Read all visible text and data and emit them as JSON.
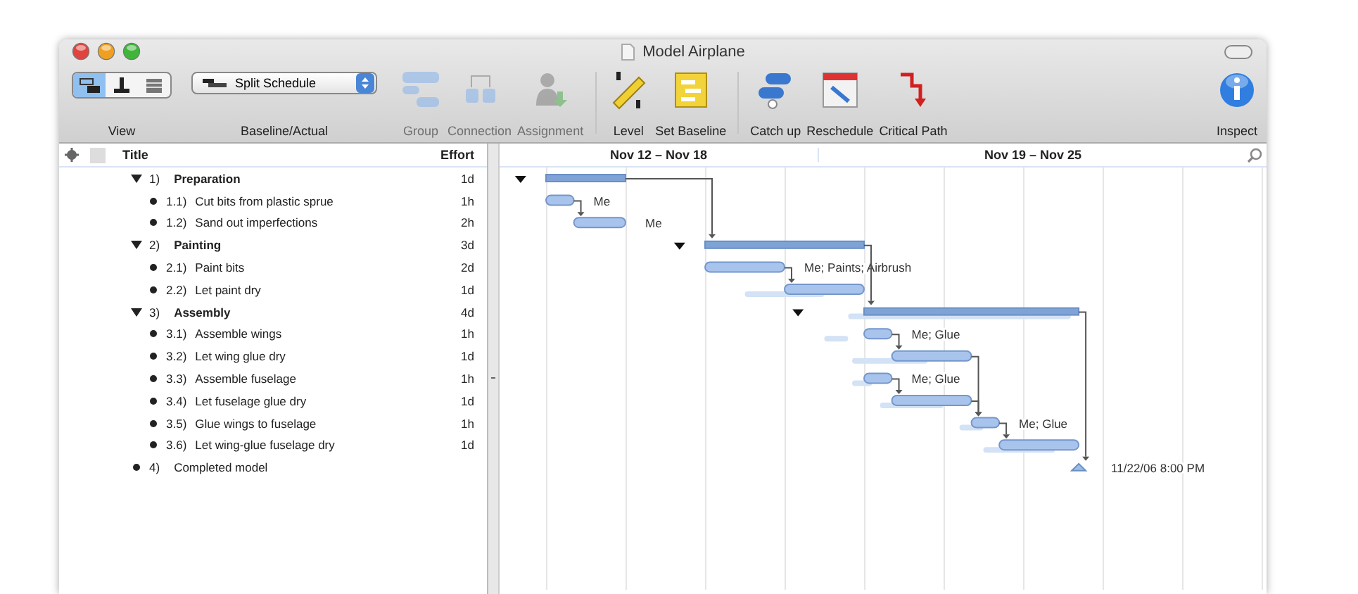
{
  "window": {
    "title": "Model Airplane"
  },
  "toolbar": {
    "view": {
      "label": "View",
      "segments": [
        {
          "selected": true
        },
        {
          "selected": false
        },
        {
          "selected": false
        }
      ]
    },
    "baseline": {
      "label": "Baseline/Actual",
      "value": "Split Schedule"
    },
    "buttons": [
      {
        "kind": "group",
        "label": "Group",
        "disabled": true
      },
      {
        "kind": "connection",
        "label": "Connection",
        "disabled": true
      },
      {
        "kind": "assignment",
        "label": "Assignment",
        "disabled": true
      },
      {
        "kind": "level",
        "label": "Level",
        "disabled": false
      },
      {
        "kind": "baseline",
        "label": "Set Baseline",
        "disabled": false
      },
      {
        "kind": "catchup",
        "label": "Catch up",
        "disabled": false
      },
      {
        "kind": "reschedule",
        "label": "Reschedule",
        "disabled": false
      },
      {
        "kind": "critical",
        "label": "Critical Path",
        "disabled": false
      },
      {
        "kind": "inspect",
        "label": "Inspect",
        "disabled": false
      }
    ]
  },
  "outline": {
    "columns": [
      "Title",
      "Effort"
    ],
    "tasks": [
      {
        "number": "1)",
        "title": "Preparation",
        "effort": "1d",
        "expanded": true,
        "children": [
          {
            "number": "1.1)",
            "title": "Cut bits from plastic sprue",
            "effort": "1h",
            "assigned": "Me"
          },
          {
            "number": "1.2)",
            "title": "Sand out imperfections",
            "effort": "2h",
            "assigned": "Me"
          }
        ]
      },
      {
        "number": "2)",
        "title": "Painting",
        "effort": "3d",
        "expanded": true,
        "children": [
          {
            "number": "2.1)",
            "title": "Paint bits",
            "effort": "2d",
            "assigned": "Me; Paints; Airbrush"
          },
          {
            "number": "2.2)",
            "title": "Let paint dry",
            "effort": "1d"
          }
        ]
      },
      {
        "number": "3)",
        "title": "Assembly",
        "effort": "4d",
        "expanded": true,
        "children": [
          {
            "number": "3.1)",
            "title": "Assemble wings",
            "effort": "1h",
            "assigned": "Me; Glue"
          },
          {
            "number": "3.2)",
            "title": "Let wing glue dry",
            "effort": "1d"
          },
          {
            "number": "3.3)",
            "title": "Assemble fuselage",
            "effort": "1h",
            "assigned": "Me; Glue"
          },
          {
            "number": "3.4)",
            "title": "Let fuselage glue dry",
            "effort": "1d"
          },
          {
            "number": "3.5)",
            "title": "Glue wings to fuselage",
            "effort": "1h",
            "assigned": "Me; Glue"
          },
          {
            "number": "3.6)",
            "title": "Let wing-glue fuselage dry",
            "effort": "1d"
          }
        ]
      },
      {
        "number": "4)",
        "title": "Completed model",
        "date": "11/22/06 8:00 PM"
      }
    ]
  },
  "gantt": {
    "weeks": [
      "Nov 12 – Nov 18",
      "Nov 19 – Nov 25"
    ]
  }
}
